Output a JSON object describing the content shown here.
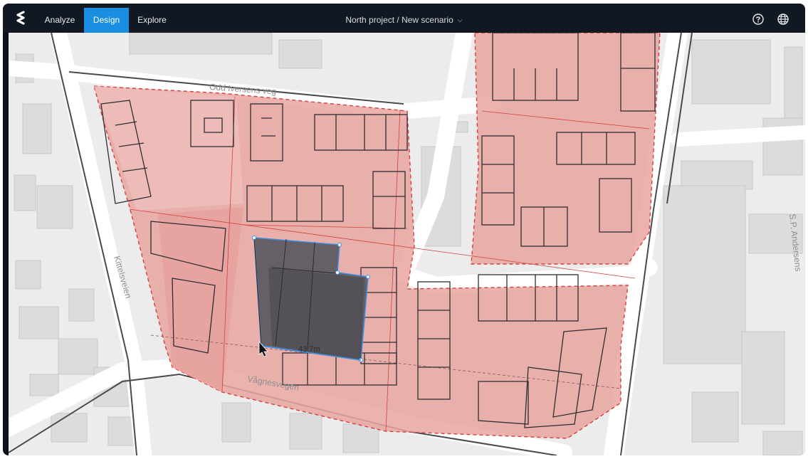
{
  "nav": {
    "tabs": [
      {
        "label": "Analyze",
        "active": false
      },
      {
        "label": "Design",
        "active": true
      },
      {
        "label": "Explore",
        "active": false
      }
    ],
    "project_label": "North project / New scenario",
    "icons": {
      "logo": "app-logo-icon",
      "help": "help-circle-icon",
      "language": "globe-icon",
      "dropdown": "chevron-down-icon"
    }
  },
  "map": {
    "street_labels": {
      "north": "Odd Iversens veg",
      "west": "Kittelsveien",
      "south": "Vågnesvegen",
      "east": "S.P. Andersens"
    },
    "measurement": "43.7m",
    "colors": {
      "accent": "#1a8ee0",
      "site_fill": "#e8a4a0",
      "selected_building": "#55535a",
      "outline": "#2e2e33",
      "dashed_boundary": "#d2423f"
    }
  }
}
